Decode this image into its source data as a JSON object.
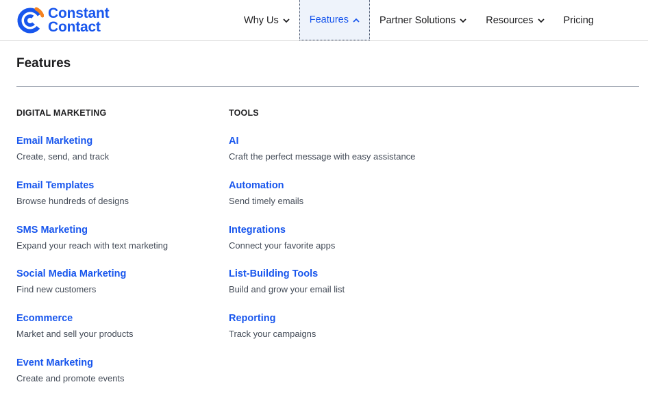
{
  "brand": {
    "line1": "Constant",
    "line2": "Contact",
    "color": "#1856ed",
    "accent": "#f58220"
  },
  "nav": {
    "items": [
      {
        "label": "Why Us",
        "icon": "chevron-down-icon"
      },
      {
        "label": "Features",
        "icon": "chevron-up-icon"
      },
      {
        "label": "Partner Solutions",
        "icon": "chevron-down-icon"
      },
      {
        "label": "Resources",
        "icon": "chevron-down-icon"
      },
      {
        "label": "Pricing"
      }
    ]
  },
  "panel": {
    "title": "Features",
    "columns": [
      {
        "heading": "DIGITAL MARKETING",
        "items": [
          {
            "title": "Email Marketing",
            "desc": "Create, send, and track"
          },
          {
            "title": "Email Templates",
            "desc": "Browse hundreds of designs"
          },
          {
            "title": "SMS Marketing",
            "desc": "Expand your reach with text marketing"
          },
          {
            "title": "Social Media Marketing",
            "desc": "Find new customers"
          },
          {
            "title": "Ecommerce",
            "desc": "Market and sell your products"
          },
          {
            "title": "Event Marketing",
            "desc": "Create and promote events"
          }
        ]
      },
      {
        "heading": "TOOLS",
        "items": [
          {
            "title": "AI",
            "desc": "Craft the perfect message with easy assistance"
          },
          {
            "title": "Automation",
            "desc": "Send timely emails"
          },
          {
            "title": "Integrations",
            "desc": "Connect your favorite apps"
          },
          {
            "title": "List-Building Tools",
            "desc": "Build and grow your email list"
          },
          {
            "title": "Reporting",
            "desc": "Track your campaigns"
          }
        ]
      }
    ]
  }
}
